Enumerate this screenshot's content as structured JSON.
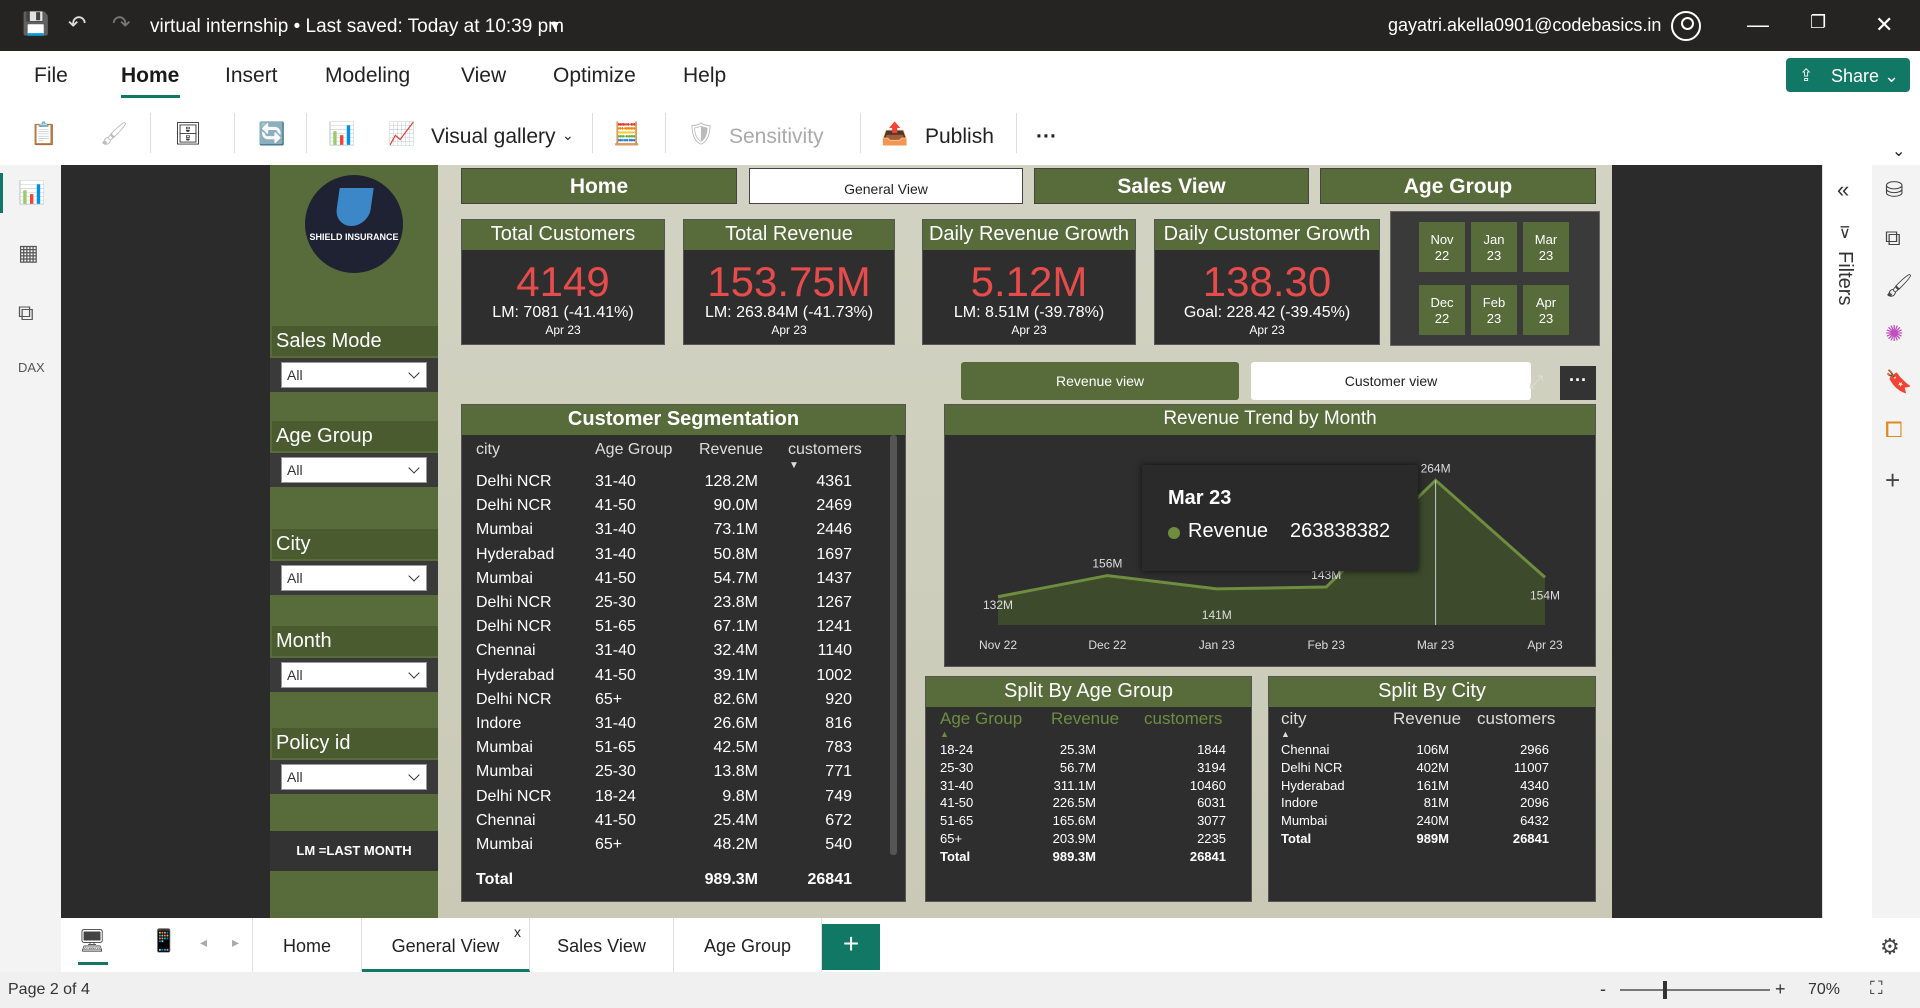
{
  "titlebar": {
    "title": "virtual internship  •  Last saved: Today at 10:39 pm",
    "user": "gayatri.akella0901@codebasics.in"
  },
  "menu": {
    "items": [
      "File",
      "Home",
      "Insert",
      "Modeling",
      "View",
      "Optimize",
      "Help"
    ],
    "share": "Share"
  },
  "ribbon": {
    "visual_gallery": "Visual gallery",
    "sensitivity": "Sensitivity",
    "publish": "Publish",
    "more": "···"
  },
  "sidebar": {
    "logo_text": "SHIELD INSURANCE",
    "slicers": [
      {
        "label": "Sales Mode",
        "value": "All"
      },
      {
        "label": "Age Group",
        "value": "All"
      },
      {
        "label": "City",
        "value": "All"
      },
      {
        "label": "Month",
        "value": "All"
      },
      {
        "label": "Policy id",
        "value": "All"
      }
    ],
    "note": "LM =LAST MONTH"
  },
  "nav": {
    "home": "Home",
    "general": "General View",
    "sales": "Sales View",
    "age": "Age Group"
  },
  "kpis": [
    {
      "title": "Total Customers",
      "value": "4149",
      "sub": "LM: 7081 (-41.41%)",
      "date": "Apr 23"
    },
    {
      "title": "Total Revenue",
      "value": "153.75M",
      "sub": "LM: 263.84M (-41.73%)",
      "date": "Apr 23"
    },
    {
      "title": "Daily Revenue Growth",
      "value": "5.12M",
      "sub": "LM: 8.51M (-39.78%)",
      "date": "Apr 23"
    },
    {
      "title": "Daily Customer Growth",
      "value": "138.30",
      "sub": "Goal: 228.42 (-39.45%)",
      "date": "Apr 23"
    }
  ],
  "months": [
    [
      "Nov",
      "22"
    ],
    [
      "Jan",
      "23"
    ],
    [
      "Mar",
      "23"
    ],
    [
      "Dec",
      "22"
    ],
    [
      "Feb",
      "23"
    ],
    [
      "Apr",
      "23"
    ]
  ],
  "views": {
    "revenue": "Revenue view",
    "customer": "Customer view"
  },
  "segmentation": {
    "title": "Customer Segmentation",
    "headers": [
      "city",
      "Age Group",
      "Revenue",
      "customers"
    ],
    "rows": [
      [
        "Delhi NCR",
        "31-40",
        "128.2M",
        "4361"
      ],
      [
        "Delhi NCR",
        "41-50",
        "90.0M",
        "2469"
      ],
      [
        "Mumbai",
        "31-40",
        "73.1M",
        "2446"
      ],
      [
        "Hyderabad",
        "31-40",
        "50.8M",
        "1697"
      ],
      [
        "Mumbai",
        "41-50",
        "54.7M",
        "1437"
      ],
      [
        "Delhi NCR",
        "25-30",
        "23.8M",
        "1267"
      ],
      [
        "Delhi NCR",
        "51-65",
        "67.1M",
        "1241"
      ],
      [
        "Chennai",
        "31-40",
        "32.4M",
        "1140"
      ],
      [
        "Hyderabad",
        "41-50",
        "39.1M",
        "1002"
      ],
      [
        "Delhi NCR",
        "65+",
        "82.6M",
        "920"
      ],
      [
        "Indore",
        "31-40",
        "26.6M",
        "816"
      ],
      [
        "Mumbai",
        "51-65",
        "42.5M",
        "783"
      ],
      [
        "Mumbai",
        "25-30",
        "13.8M",
        "771"
      ],
      [
        "Delhi NCR",
        "18-24",
        "9.8M",
        "749"
      ],
      [
        "Chennai",
        "41-50",
        "25.4M",
        "672"
      ],
      [
        "Mumbai",
        "65+",
        "48.2M",
        "540"
      ]
    ],
    "total": [
      "Total",
      "",
      "989.3M",
      "26841"
    ]
  },
  "trend": {
    "title": "Revenue Trend by Month",
    "tooltip_month": "Mar 23",
    "tooltip_label": "Revenue",
    "tooltip_value": "263838382"
  },
  "chart_data": {
    "type": "area",
    "title": "Revenue Trend by Month",
    "categories": [
      "Nov 22",
      "Dec 22",
      "Jan 23",
      "Feb 23",
      "Mar 23",
      "Apr 23"
    ],
    "values": [
      132,
      156,
      141,
      143,
      264,
      154
    ],
    "labels": [
      "132M",
      "156M",
      "141M",
      "143M",
      "264M",
      "154M"
    ],
    "unit": "M"
  },
  "split_age": {
    "title": "Split By Age Group",
    "headers": [
      "Age Group",
      "Revenue",
      "customers"
    ],
    "rows": [
      [
        "18-24",
        "25.3M",
        "1844"
      ],
      [
        "25-30",
        "56.7M",
        "3194"
      ],
      [
        "31-40",
        "311.1M",
        "10460"
      ],
      [
        "41-50",
        "226.5M",
        "6031"
      ],
      [
        "51-65",
        "165.6M",
        "3077"
      ],
      [
        "65+",
        "203.9M",
        "2235"
      ]
    ],
    "total": [
      "Total",
      "989.3M",
      "26841"
    ]
  },
  "split_city": {
    "title": "Split By City",
    "headers": [
      "city",
      "Revenue",
      "customers"
    ],
    "rows": [
      [
        "Chennai",
        "106M",
        "2966"
      ],
      [
        "Delhi NCR",
        "402M",
        "11007"
      ],
      [
        "Hyderabad",
        "161M",
        "4340"
      ],
      [
        "Indore",
        "81M",
        "2096"
      ],
      [
        "Mumbai",
        "240M",
        "6432"
      ]
    ],
    "total": [
      "Total",
      "989M",
      "26841"
    ]
  },
  "tabs": {
    "home": "Home",
    "general": "General View",
    "sales": "Sales View",
    "age": "Age Group",
    "close": "x"
  },
  "rightpane": {
    "filters": "Filters"
  },
  "status": {
    "page": "Page 2 of 4",
    "zoom": "70%"
  }
}
